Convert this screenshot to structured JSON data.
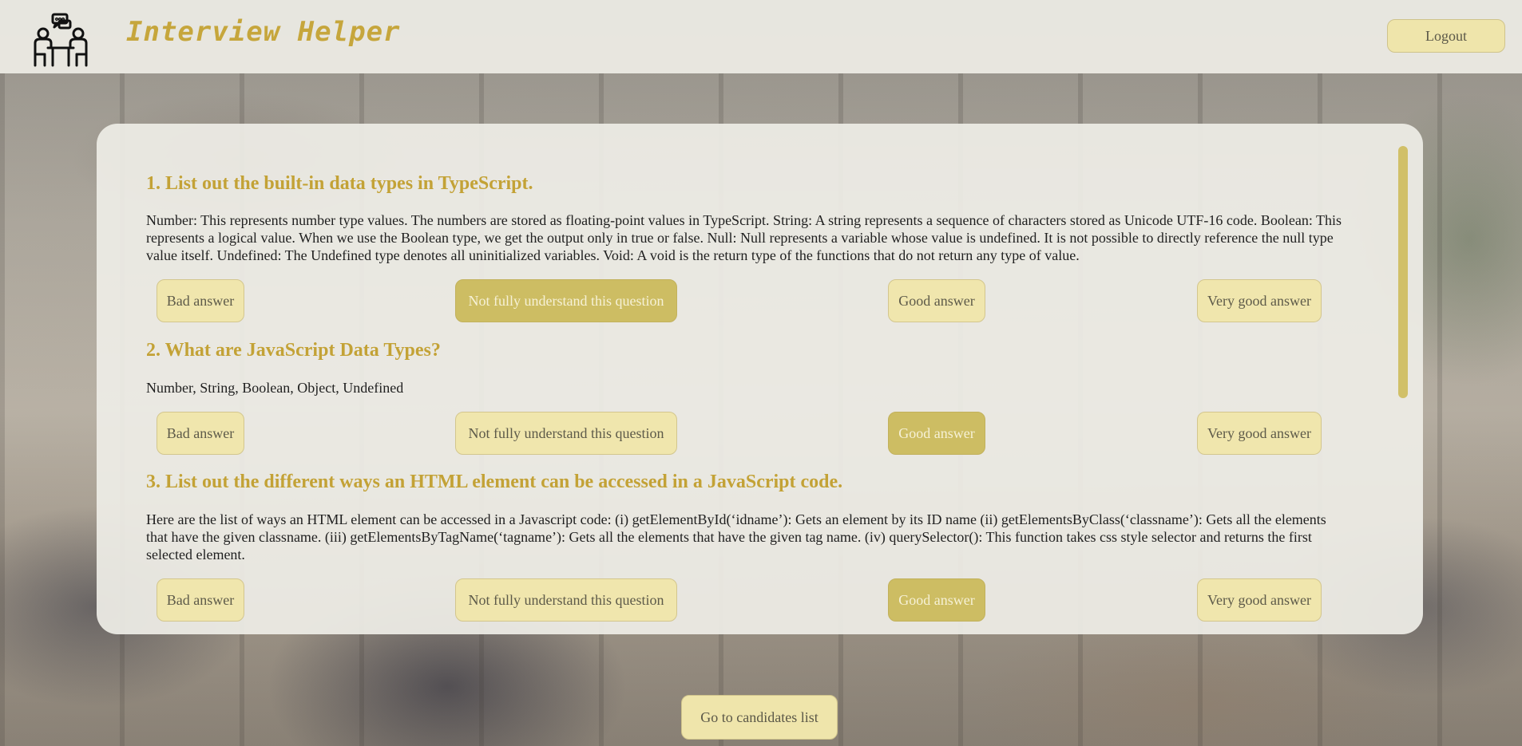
{
  "app": {
    "brand": "Interview Helper",
    "logout_label": "Logout"
  },
  "questions": [
    {
      "title": "1. List out the built-in data types in TypeScript.",
      "answer": "Number: This represents number type values. The numbers are stored as floating-point values in TypeScript. String: A string represents a sequence of characters stored as Unicode UTF-16 code. Boolean: This represents a logical value. When we use the Boolean type, we get the output only in true or false. Null: Null represents a variable whose value is undefined. It is not possible to directly reference the null type value itself. Undefined: The Undefined type denotes all uninitialized variables. Void: A void is the return type of the functions that do not return any type of value.",
      "selected": "not_fully"
    },
    {
      "title": "2. What are JavaScript Data Types?",
      "answer": "Number, String, Boolean, Object, Undefined",
      "selected": "good"
    },
    {
      "title": "3. List out the different ways an HTML element can be accessed in a JavaScript code.",
      "answer": "Here are the list of ways an HTML element can be accessed in a Javascript code: (i) getElementById(‘idname’): Gets an element by its ID name (ii) getElementsByClass(‘classname’): Gets all the elements that have the given classname. (iii) getElementsByTagName(‘tagname’): Gets all the elements that have the given tag name. (iv) querySelector(): This function takes css style selector and returns the first selected element.",
      "selected": "good"
    }
  ],
  "rating_labels": {
    "bad": "Bad answer",
    "not_fully": "Not fully understand this question",
    "good": "Good answer",
    "very_good": "Very good answer"
  },
  "footer": {
    "go_to_candidates_label": "Go to candidates list"
  },
  "colors": {
    "accent": "#c6a63c",
    "button_bg": "#efe5ab",
    "button_selected_bg": "#cdbd63"
  }
}
